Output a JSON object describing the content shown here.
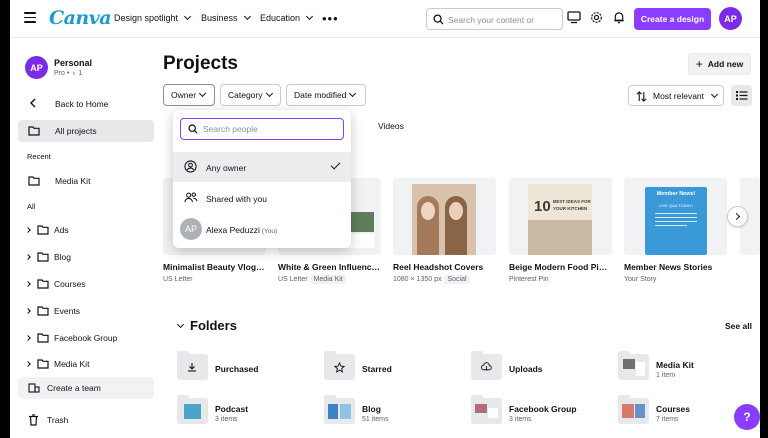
{
  "app": {
    "logo": "Canva"
  },
  "topnav": [
    {
      "label": "Design spotlight"
    },
    {
      "label": "Business"
    },
    {
      "label": "Education"
    }
  ],
  "search": {
    "placeholder": "Search your content or"
  },
  "header": {
    "create_label": "Create a design",
    "avatar_initials": "AP"
  },
  "account": {
    "initials": "AP",
    "name": "Personal",
    "sub": "Pro • ♁ 1"
  },
  "sidebar": {
    "back_label": "Back to Home",
    "all_projects_label": "All projects",
    "recent_heading": "Recent",
    "recent_items": [
      "Media Kit"
    ],
    "all_heading": "All",
    "folders": [
      "Ads",
      "Blog",
      "Courses",
      "Events",
      "Facebook Group",
      "Media Kit"
    ],
    "create_team_label": "Create a team",
    "trash_label": "Trash"
  },
  "main": {
    "title": "Projects",
    "add_new_label": "Add new",
    "filters": {
      "owner": "Owner",
      "category": "Category",
      "date": "Date modified"
    },
    "sort_label": "Most relevant",
    "tabs": [
      "s",
      "Videos"
    ]
  },
  "owner_dropdown": {
    "search_placeholder": "Search people",
    "options": [
      {
        "label": "Any owner",
        "selected": true
      },
      {
        "label": "Shared with you"
      },
      {
        "label": "Alexa Peduzzi",
        "suffix": "(You)",
        "initials": "AP"
      }
    ]
  },
  "designs": [
    {
      "title": "Minimalist Beauty Vlogge...",
      "meta": "US Letter",
      "tag": ""
    },
    {
      "title": "White & Green Influencer...",
      "meta": "US Letter",
      "tag": "Media Kit"
    },
    {
      "title": "Reel Headshot Covers",
      "meta": "1080 × 1350 px",
      "tag": "Social"
    },
    {
      "title": "Beige Modern Food Pinte...",
      "meta": "Pinterest Pin",
      "tag": ""
    },
    {
      "title": "Member News Stories",
      "meta": "Your Story",
      "tag": ""
    }
  ],
  "thumb_text": {
    "food_line1": "10",
    "food_line2": "BEST IDEAS FOR",
    "food_line3": "YOUR KITCHEN",
    "news_title": "Member News!",
    "news_sub": "LIVE Q&A TODAY!"
  },
  "folders_section": {
    "title": "Folders",
    "see_all": "See all",
    "items": [
      {
        "name": "Purchased",
        "count": ""
      },
      {
        "name": "Starred",
        "count": ""
      },
      {
        "name": "Uploads",
        "count": ""
      },
      {
        "name": "Media Kit",
        "count": "1 item"
      },
      {
        "name": "Podcast",
        "count": "3 items"
      },
      {
        "name": "Blog",
        "count": "51 items"
      },
      {
        "name": "Facebook Group",
        "count": "3 items"
      },
      {
        "name": "Courses",
        "count": "7 items"
      }
    ]
  },
  "help": {
    "label": "?"
  },
  "colors": {
    "brand_purple": "#8b3dff",
    "logo_blue": "#1d9bd1",
    "avatar_purple": "#7d2ae8"
  }
}
